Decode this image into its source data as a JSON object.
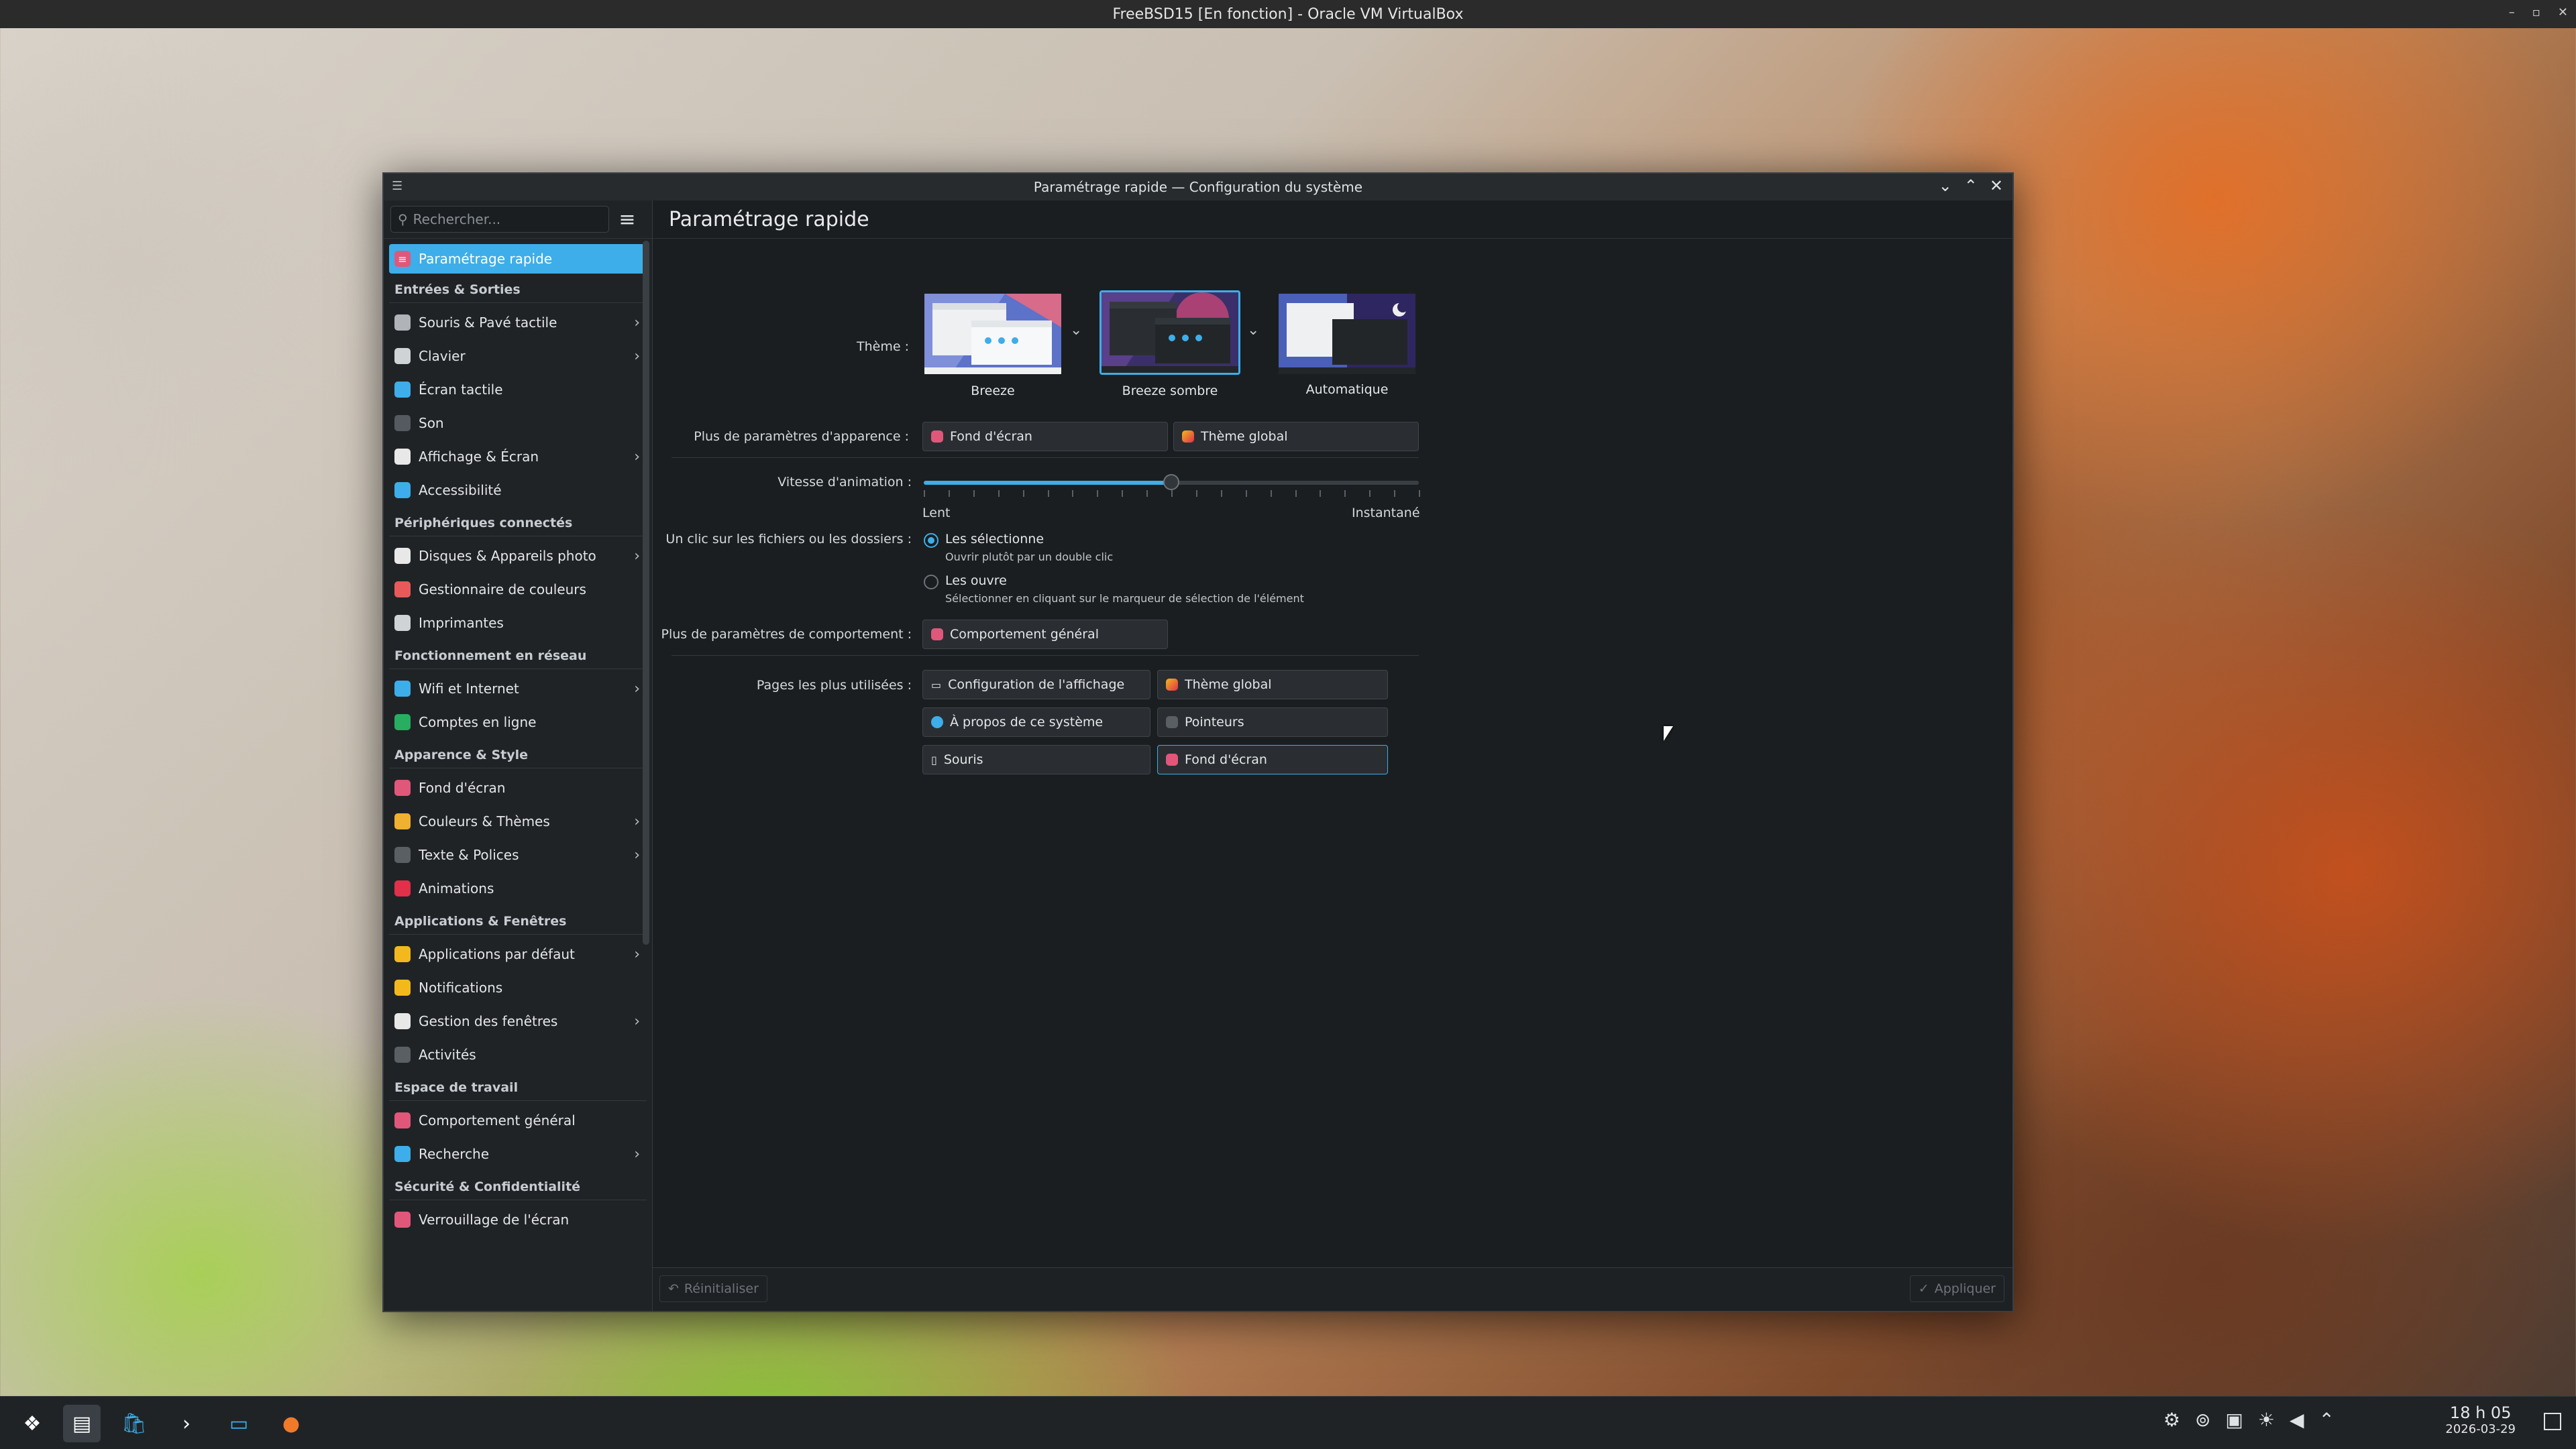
{
  "vbox": {
    "title": "FreeBSD15 [En fonction] - Oracle VM VirtualBox"
  },
  "window": {
    "title": "Paramétrage rapide — Configuration du système"
  },
  "sidebar": {
    "search_placeholder": "Rechercher...",
    "active": "Paramétrage rapide",
    "sections": [
      {
        "title": "Entrées & Sorties",
        "items": [
          {
            "label": "Souris & Pavé tactile",
            "chevron": true,
            "icon": "mouse-icon",
            "color": "#b0b4b8"
          },
          {
            "label": "Clavier",
            "chevron": true,
            "icon": "keyboard-icon",
            "color": "#d0d3d6"
          },
          {
            "label": "Écran tactile",
            "chevron": false,
            "icon": "touchscreen-icon",
            "color": "#3daee9"
          },
          {
            "label": "Son",
            "chevron": false,
            "icon": "speaker-icon",
            "color": "#555a60"
          },
          {
            "label": "Affichage & Écran",
            "chevron": true,
            "icon": "display-icon",
            "color": "#e8e8e8"
          },
          {
            "label": "Accessibilité",
            "chevron": false,
            "icon": "accessibility-icon",
            "color": "#3daee9"
          }
        ]
      },
      {
        "title": "Périphériques connectés",
        "items": [
          {
            "label": "Disques & Appareils photo",
            "chevron": true,
            "icon": "disk-icon",
            "color": "#e8e8e8"
          },
          {
            "label": "Gestionnaire de couleurs",
            "chevron": false,
            "icon": "color-wheel-icon",
            "color": "#e85a5a"
          },
          {
            "label": "Imprimantes",
            "chevron": false,
            "icon": "printer-icon",
            "color": "#d0d3d6"
          }
        ]
      },
      {
        "title": "Fonctionnement en réseau",
        "items": [
          {
            "label": "Wifi et Internet",
            "chevron": true,
            "icon": "globe-icon",
            "color": "#3daee9"
          },
          {
            "label": "Comptes en ligne",
            "chevron": false,
            "icon": "online-accounts-icon",
            "color": "#27ae60"
          }
        ]
      },
      {
        "title": "Apparence & Style",
        "items": [
          {
            "label": "Fond d'écran",
            "chevron": false,
            "icon": "wallpaper-icon",
            "color": "#e0577a"
          },
          {
            "label": "Couleurs & Thèmes",
            "chevron": true,
            "icon": "palette-icon",
            "color": "#f0b030"
          },
          {
            "label": "Texte & Polices",
            "chevron": true,
            "icon": "font-icon",
            "color": "#5a5f64"
          },
          {
            "label": "Animations",
            "chevron": false,
            "icon": "animation-icon",
            "color": "#e0304a"
          }
        ]
      },
      {
        "title": "Applications & Fenêtres",
        "items": [
          {
            "label": "Applications par défaut",
            "chevron": true,
            "icon": "star-icon",
            "color": "#f3b91c"
          },
          {
            "label": "Notifications",
            "chevron": false,
            "icon": "bell-icon",
            "color": "#f3b91c"
          },
          {
            "label": "Gestion des fenêtres",
            "chevron": true,
            "icon": "window-icon",
            "color": "#e8e8e8"
          },
          {
            "label": "Activités",
            "chevron": false,
            "icon": "activities-icon",
            "color": "#5a5f64"
          }
        ]
      },
      {
        "title": "Espace de travail",
        "items": [
          {
            "label": "Comportement général",
            "chevron": false,
            "icon": "general-behavior-icon",
            "color": "#e0577a"
          },
          {
            "label": "Recherche",
            "chevron": true,
            "icon": "search-icon",
            "color": "#3daee9"
          }
        ]
      },
      {
        "title": "Sécurité & Confidentialité",
        "items": [
          {
            "label": "Verrouillage de l'écran",
            "chevron": false,
            "icon": "lock-screen-icon",
            "color": "#e0577a"
          }
        ]
      }
    ]
  },
  "main": {
    "header": "Paramétrage rapide",
    "theme_label": "Thème :",
    "themes": [
      {
        "name": "Breeze",
        "selected": false
      },
      {
        "name": "Breeze sombre",
        "selected": true
      },
      {
        "name": "Automatique",
        "selected": false
      }
    ],
    "appearance_label": "Plus de paramètres d'apparence :",
    "appearance_buttons": [
      "Fond d'écran",
      "Thème global"
    ],
    "animation_label": "Vitesse d'animation :",
    "animation_min": "Lent",
    "animation_max": "Instantané",
    "animation_value": 0.5,
    "click_label": "Un clic sur les fichiers ou les dossiers :",
    "click_options": [
      {
        "label": "Les sélectionne",
        "hint": "Ouvrir plutôt par un double clic",
        "selected": true
      },
      {
        "label": "Les ouvre",
        "hint": "Sélectionner en cliquant sur le marqueur de sélection de l'élément",
        "selected": false
      }
    ],
    "behavior_label": "Plus de paramètres de comportement :",
    "behavior_button": "Comportement général",
    "pages_label": "Pages les plus utilisées :",
    "pages": [
      "Configuration de l'affichage",
      "Thème global",
      "À propos de ce système",
      "Pointeurs",
      "Souris",
      "Fond d'écran"
    ],
    "reset": "Réinitialiser",
    "apply": "Appliquer"
  },
  "taskbar": {
    "time": "18 h 05",
    "date": "2026-03-29"
  }
}
